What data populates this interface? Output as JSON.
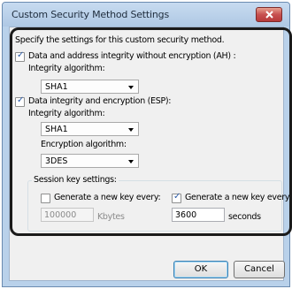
{
  "window": {
    "title": "Custom Security Method Settings"
  },
  "dialog": {
    "intro": "Specify the settings for this custom security method.",
    "ah": {
      "label": "Data and address integrity without encryption (AH) :",
      "checked": true,
      "integrity_label": "Integrity algorithm:",
      "integrity_value": "SHA1"
    },
    "esp": {
      "label": "Data integrity and encryption (ESP):",
      "checked": true,
      "integrity_label": "Integrity algorithm:",
      "integrity_value": "SHA1",
      "encryption_label": "Encryption algorithm:",
      "encryption_value": "3DES"
    },
    "session": {
      "label": "Session key settings:",
      "kbytes": {
        "label": "Generate a new key every:",
        "checked": false,
        "value": "100000",
        "unit": "Kbytes"
      },
      "seconds": {
        "label": "Generate a new key every:",
        "checked": true,
        "value": "3600",
        "unit": "seconds"
      }
    },
    "buttons": {
      "ok": "OK",
      "cancel": "Cancel"
    }
  }
}
